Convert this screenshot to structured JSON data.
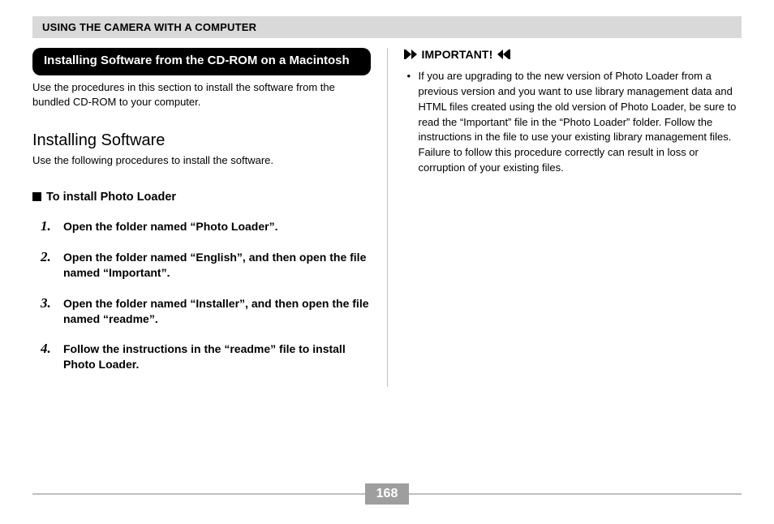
{
  "header": "USING THE CAMERA WITH A COMPUTER",
  "left": {
    "pill": "Installing Software from the CD-ROM on a Macintosh",
    "intro": "Use the procedures in this section to install the software from the bundled CD-ROM to your computer.",
    "h2": "Installing Software",
    "sub": "Use the following procedures to install the software.",
    "h3": "To install Photo Loader",
    "steps": [
      {
        "n": "1.",
        "t": "Open the folder named “Photo Loader”."
      },
      {
        "n": "2.",
        "t": "Open the folder named “English”, and then open the file named “Important”."
      },
      {
        "n": "3.",
        "t": "Open the folder named “Installer”, and then open the file named “readme”."
      },
      {
        "n": "4.",
        "t": "Follow the instructions in the “readme” file to install Photo Loader."
      }
    ]
  },
  "right": {
    "important_label": "IMPORTANT!",
    "important_text": "If you are upgrading to the new version of Photo Loader from a previous version and you want to use library management data and HTML files created using the old version of Photo Loader, be sure to read the “Important” file in the “Photo Loader” folder. Follow the instructions in the file to use your existing library management files. Failure to follow this procedure correctly can result in loss or corruption of your existing files."
  },
  "page_number": "168"
}
